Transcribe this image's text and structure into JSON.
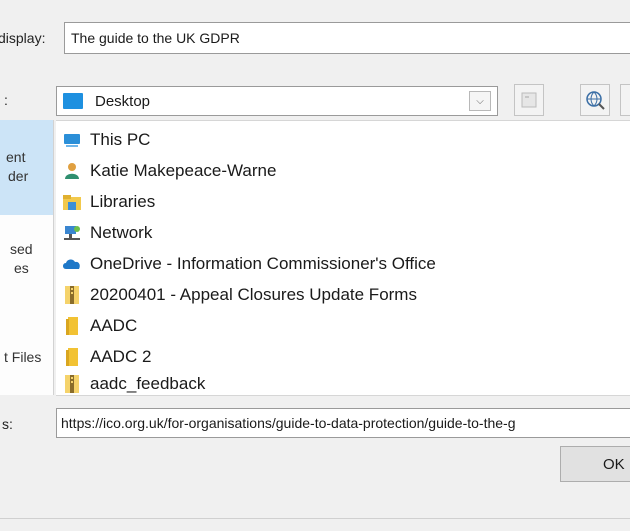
{
  "display": {
    "label": "display:",
    "value": "The guide to the UK GDPR"
  },
  "lookin": {
    "label": ":",
    "value": "Desktop"
  },
  "places": [
    {
      "line1": "ent",
      "line2": "der",
      "selected": true
    },
    {
      "line1": "sed",
      "line2": "es",
      "selected": false
    },
    {
      "line1": "t Files",
      "line2": "",
      "selected": false
    }
  ],
  "items": [
    {
      "label": "This PC",
      "icon": "computer-icon"
    },
    {
      "label": "Katie Makepeace-Warne",
      "icon": "user-icon"
    },
    {
      "label": "Libraries",
      "icon": "library-icon"
    },
    {
      "label": "Network",
      "icon": "network-icon"
    },
    {
      "label": "OneDrive - Information Commissioner's Office",
      "icon": "cloud-icon"
    },
    {
      "label": "20200401 - Appeal Closures Update Forms",
      "icon": "zip-folder-icon"
    },
    {
      "label": "AADC",
      "icon": "folder-icon"
    },
    {
      "label": "AADC 2",
      "icon": "folder-icon"
    },
    {
      "label": "aadc_feedback",
      "icon": "zip-folder-icon"
    }
  ],
  "address": {
    "label": "s:",
    "value": "https://ico.org.uk/for-organisations/guide-to-data-protection/guide-to-the-g"
  },
  "buttons": {
    "ok": "OK"
  }
}
